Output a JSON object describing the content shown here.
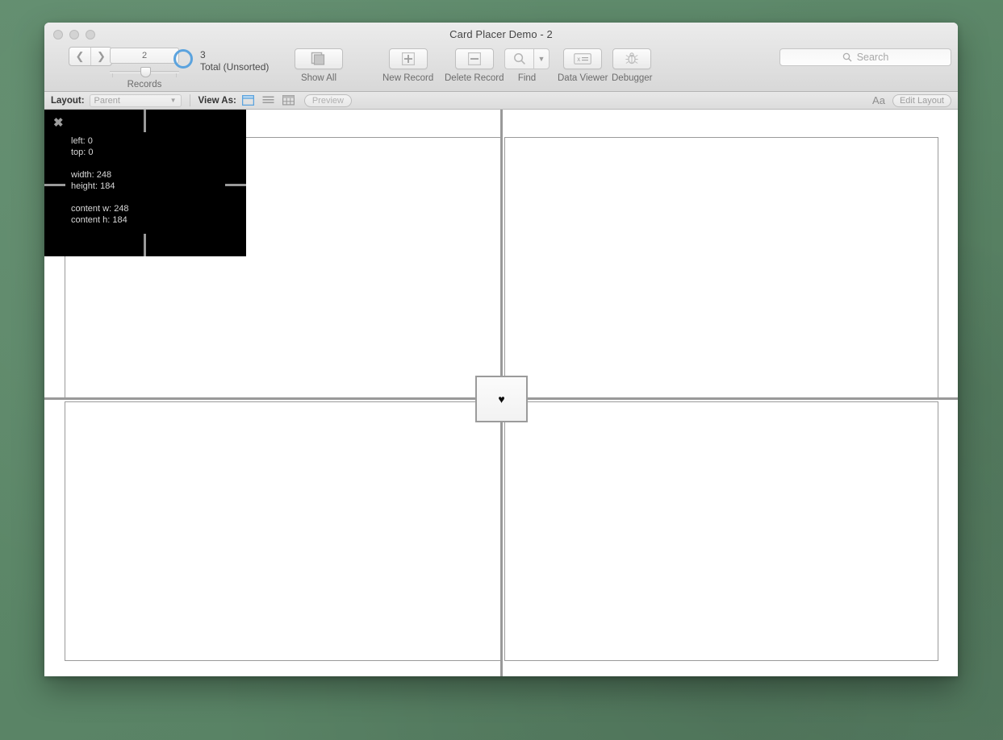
{
  "window": {
    "title": "Card Placer Demo - 2",
    "traffic_lights": [
      "close",
      "minimize",
      "zoom"
    ]
  },
  "toolbar": {
    "nav": {
      "prev_icon": "chevron-left",
      "next_icon": "chevron-right"
    },
    "records": {
      "current_record": "2",
      "group_label": "Records",
      "total_count": "3",
      "total_label": "Total (Unsorted)"
    },
    "buttons": [
      {
        "name": "show-all",
        "label": "Show All",
        "icon": "stack-icon"
      },
      {
        "name": "new-record",
        "label": "New Record",
        "icon": "plus-icon"
      },
      {
        "name": "delete-record",
        "label": "Delete Record",
        "icon": "minus-icon"
      },
      {
        "name": "find",
        "label": "Find",
        "icon": "magnifier-icon"
      },
      {
        "name": "data-viewer",
        "label": "Data Viewer",
        "icon": "data-viewer-icon"
      },
      {
        "name": "debugger",
        "label": "Debugger",
        "icon": "bug-icon"
      }
    ],
    "search": {
      "placeholder": "Search",
      "value": "",
      "icon": "search-icon"
    }
  },
  "layout_bar": {
    "layout_label": "Layout:",
    "layout_value": "Parent",
    "view_as_label": "View As:",
    "view_as_options": [
      "form-view",
      "list-view",
      "table-view"
    ],
    "view_as_selected": "form-view",
    "preview_label": "Preview",
    "text_format_icon": "Aa",
    "edit_layout_label": "Edit Layout"
  },
  "canvas": {
    "card": {
      "icon": "heart-icon",
      "glyph": "♥"
    }
  },
  "inspector": {
    "close_icon": "close-x-icon",
    "metrics": [
      {
        "label": "left",
        "value": "0"
      },
      {
        "label": "top",
        "value": "0"
      },
      {
        "label": "width",
        "value": "248"
      },
      {
        "label": "height",
        "value": "184"
      },
      {
        "label": "content w",
        "value": "248"
      },
      {
        "label": "content h",
        "value": "184"
      }
    ],
    "lines": {
      "left": "left: 0",
      "top": "top: 0",
      "width": "width: 248",
      "height": "height: 184",
      "content_w": "content w: 248",
      "content_h": "content h: 184"
    }
  },
  "colors": {
    "accent": "#5ba3de",
    "desktop": "#5f8a6d",
    "grid_line": "#999999",
    "panel_border": "#9a9a9a",
    "inspector_bg": "#000000"
  }
}
